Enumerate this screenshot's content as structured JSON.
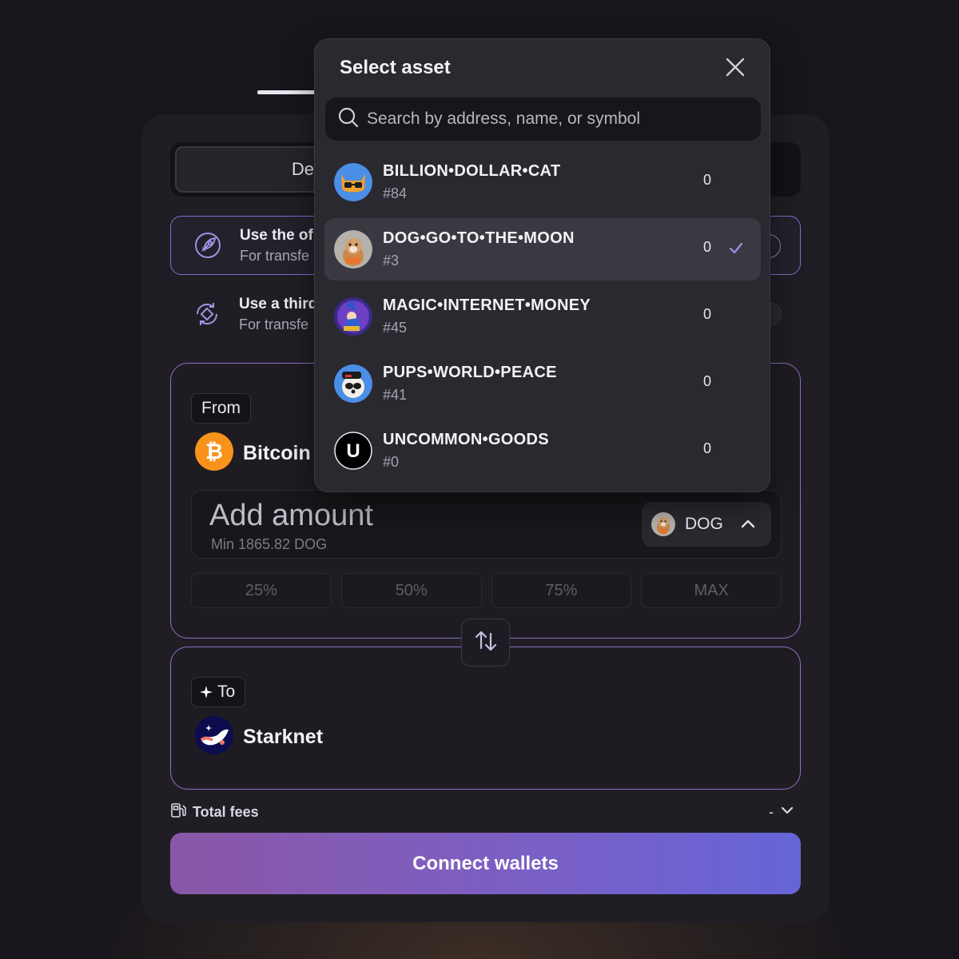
{
  "background_tab": {
    "active_label": "De"
  },
  "options": [
    {
      "title": "Use the of",
      "subtitle": "For transfe",
      "selected": true
    },
    {
      "title": "Use a third",
      "subtitle": "For transfe",
      "selected": false
    }
  ],
  "from": {
    "label": "From",
    "chain": "Bitcoin",
    "amount_placeholder": "Add amount",
    "min_text": "Min 1865.82 DOG",
    "token_symbol": "DOG",
    "percent_buttons": [
      "25%",
      "50%",
      "75%",
      "MAX"
    ]
  },
  "to": {
    "label": "To",
    "chain": "Starknet"
  },
  "fees": {
    "label": "Total fees",
    "value": "-"
  },
  "connect_button": "Connect wallets",
  "modal": {
    "title": "Select asset",
    "search_placeholder": "Search by address, name, or symbol",
    "assets": [
      {
        "name": "BILLION•DOLLAR•CAT",
        "number": "#84",
        "balance": "0",
        "selected": false
      },
      {
        "name": "DOG•GO•TO•THE•MOON",
        "number": "#3",
        "balance": "0",
        "selected": true
      },
      {
        "name": "MAGIC•INTERNET•MONEY",
        "number": "#45",
        "balance": "0",
        "selected": false
      },
      {
        "name": "PUPS•WORLD•PEACE",
        "number": "#41",
        "balance": "0",
        "selected": false
      },
      {
        "name": "UNCOMMON•GOODS",
        "number": "#0",
        "balance": "0",
        "selected": false
      }
    ]
  },
  "icons": {
    "uncommon_goods_letter": "U",
    "bitcoin_symbol": "₿"
  },
  "colors": {
    "accent_border": "#8d72c8",
    "button_gradient_start": "#8a57a6",
    "button_gradient_end": "#6665d8",
    "bitcoin_orange": "#f7931a",
    "check": "#9d93e6"
  }
}
